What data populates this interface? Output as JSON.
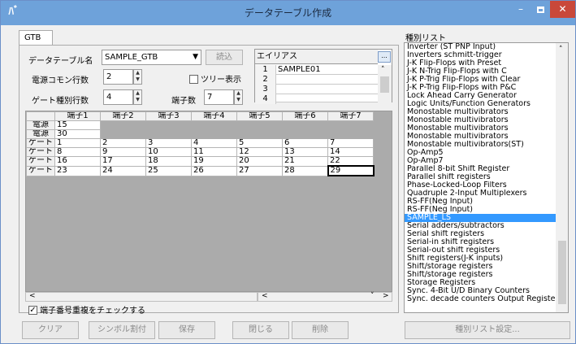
{
  "window": {
    "title": "データテーブル作成",
    "app_icon": "ﾊﾞ"
  },
  "controls": {
    "minimize": "–",
    "close": "✕"
  },
  "tab": {
    "label": "GTB"
  },
  "form": {
    "table_name_label": "データテーブル名",
    "table_name_value": "SAMPLE_GTB",
    "load_button": "読込",
    "power_rows_label": "電源コモン行数",
    "power_rows_value": "2",
    "tree_view_label": "ツリー表示",
    "gate_rows_label": "ゲート種別行数",
    "gate_rows_value": "4",
    "pins_label": "端子数",
    "pins_value": "7"
  },
  "alias": {
    "header": "エイリアス",
    "dots": "...",
    "rows": [
      {
        "n": "1",
        "v": "SAMPLE01"
      },
      {
        "n": "2",
        "v": ""
      },
      {
        "n": "3",
        "v": ""
      },
      {
        "n": "4",
        "v": ""
      }
    ]
  },
  "grid": {
    "headers": [
      "",
      "端子1",
      "端子2",
      "端子3",
      "端子4",
      "端子5",
      "端子6",
      "端子7"
    ],
    "rows": [
      {
        "label": "電源",
        "cells": [
          "15"
        ]
      },
      {
        "label": "電源",
        "cells": [
          "30"
        ]
      },
      {
        "label": "ゲート",
        "cells": [
          "1",
          "2",
          "3",
          "4",
          "5",
          "6",
          "7"
        ]
      },
      {
        "label": "ゲート",
        "cells": [
          "8",
          "9",
          "10",
          "11",
          "12",
          "13",
          "14"
        ]
      },
      {
        "label": "ゲート",
        "cells": [
          "16",
          "17",
          "18",
          "19",
          "20",
          "21",
          "22"
        ]
      },
      {
        "label": "ゲート",
        "cells": [
          "23",
          "24",
          "25",
          "26",
          "27",
          "28",
          "29"
        ]
      }
    ]
  },
  "dup_check_label": "端子番号重複をチェックする",
  "type_list": {
    "title": "種別リスト",
    "selected": "SAMPLE_LS",
    "items": [
      "Inverter (ST PNP Input)",
      "Inverters schmitt-trigger",
      "J-K Flip-Flops with Preset",
      "J-K N-Trig Flip-Flops with C",
      "J-K P-Trig Flip-Flops with Clear",
      "J-K P-Trig Flip-Flops with P&C",
      "Lock Ahead Carry Generator",
      "Logic Units/Function Generators",
      "Monostable multivibrators",
      "Monostable multivibrators",
      "Monostable multivibrators",
      "Monostable multivibrators",
      "Monostable multivibrators(ST)",
      "Op-Amp5",
      "Op-Amp7",
      "Parallel 8-bit Shift Register",
      "Parallel shift registers",
      "Phase-Locked-Loop Filters",
      "Quadruple 2-Input Multiplexers",
      "RS-FF(Neg Input)",
      "RS-FF(Neg Input)",
      "SAMPLE_LS",
      "Serial adders/subtractors",
      "Serial shift registers",
      "Serial-in shift registers",
      "Serial-out shift registers",
      "Shift registers(J-K inputs)",
      "Shift/storage registers",
      "Shift/storage registers",
      "Storage Registers",
      "Sync. 4-Bit U/D Binary Counters",
      "Sync. decade counters Output Registers"
    ]
  },
  "buttons": {
    "clear": "クリア",
    "symbol_assign": "シンボル割付",
    "save": "保存",
    "close": "閉じる",
    "delete": "削除",
    "type_list_settings": "種別リスト設定..."
  }
}
